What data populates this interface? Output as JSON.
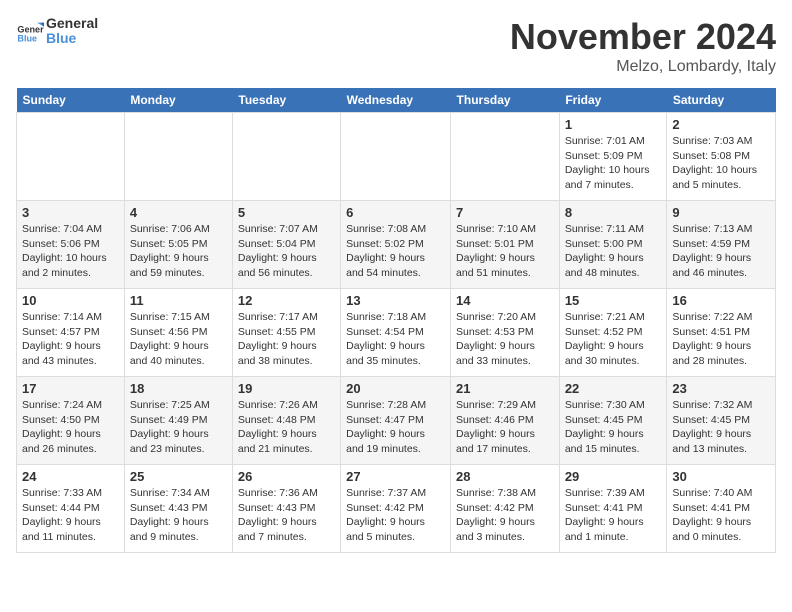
{
  "header": {
    "logo_general": "General",
    "logo_blue": "Blue",
    "month_title": "November 2024",
    "location": "Melzo, Lombardy, Italy"
  },
  "days_of_week": [
    "Sunday",
    "Monday",
    "Tuesday",
    "Wednesday",
    "Thursday",
    "Friday",
    "Saturday"
  ],
  "weeks": [
    [
      {
        "day": "",
        "info": ""
      },
      {
        "day": "",
        "info": ""
      },
      {
        "day": "",
        "info": ""
      },
      {
        "day": "",
        "info": ""
      },
      {
        "day": "",
        "info": ""
      },
      {
        "day": "1",
        "info": "Sunrise: 7:01 AM\nSunset: 5:09 PM\nDaylight: 10 hours and 7 minutes."
      },
      {
        "day": "2",
        "info": "Sunrise: 7:03 AM\nSunset: 5:08 PM\nDaylight: 10 hours and 5 minutes."
      }
    ],
    [
      {
        "day": "3",
        "info": "Sunrise: 7:04 AM\nSunset: 5:06 PM\nDaylight: 10 hours and 2 minutes."
      },
      {
        "day": "4",
        "info": "Sunrise: 7:06 AM\nSunset: 5:05 PM\nDaylight: 9 hours and 59 minutes."
      },
      {
        "day": "5",
        "info": "Sunrise: 7:07 AM\nSunset: 5:04 PM\nDaylight: 9 hours and 56 minutes."
      },
      {
        "day": "6",
        "info": "Sunrise: 7:08 AM\nSunset: 5:02 PM\nDaylight: 9 hours and 54 minutes."
      },
      {
        "day": "7",
        "info": "Sunrise: 7:10 AM\nSunset: 5:01 PM\nDaylight: 9 hours and 51 minutes."
      },
      {
        "day": "8",
        "info": "Sunrise: 7:11 AM\nSunset: 5:00 PM\nDaylight: 9 hours and 48 minutes."
      },
      {
        "day": "9",
        "info": "Sunrise: 7:13 AM\nSunset: 4:59 PM\nDaylight: 9 hours and 46 minutes."
      }
    ],
    [
      {
        "day": "10",
        "info": "Sunrise: 7:14 AM\nSunset: 4:57 PM\nDaylight: 9 hours and 43 minutes."
      },
      {
        "day": "11",
        "info": "Sunrise: 7:15 AM\nSunset: 4:56 PM\nDaylight: 9 hours and 40 minutes."
      },
      {
        "day": "12",
        "info": "Sunrise: 7:17 AM\nSunset: 4:55 PM\nDaylight: 9 hours and 38 minutes."
      },
      {
        "day": "13",
        "info": "Sunrise: 7:18 AM\nSunset: 4:54 PM\nDaylight: 9 hours and 35 minutes."
      },
      {
        "day": "14",
        "info": "Sunrise: 7:20 AM\nSunset: 4:53 PM\nDaylight: 9 hours and 33 minutes."
      },
      {
        "day": "15",
        "info": "Sunrise: 7:21 AM\nSunset: 4:52 PM\nDaylight: 9 hours and 30 minutes."
      },
      {
        "day": "16",
        "info": "Sunrise: 7:22 AM\nSunset: 4:51 PM\nDaylight: 9 hours and 28 minutes."
      }
    ],
    [
      {
        "day": "17",
        "info": "Sunrise: 7:24 AM\nSunset: 4:50 PM\nDaylight: 9 hours and 26 minutes."
      },
      {
        "day": "18",
        "info": "Sunrise: 7:25 AM\nSunset: 4:49 PM\nDaylight: 9 hours and 23 minutes."
      },
      {
        "day": "19",
        "info": "Sunrise: 7:26 AM\nSunset: 4:48 PM\nDaylight: 9 hours and 21 minutes."
      },
      {
        "day": "20",
        "info": "Sunrise: 7:28 AM\nSunset: 4:47 PM\nDaylight: 9 hours and 19 minutes."
      },
      {
        "day": "21",
        "info": "Sunrise: 7:29 AM\nSunset: 4:46 PM\nDaylight: 9 hours and 17 minutes."
      },
      {
        "day": "22",
        "info": "Sunrise: 7:30 AM\nSunset: 4:45 PM\nDaylight: 9 hours and 15 minutes."
      },
      {
        "day": "23",
        "info": "Sunrise: 7:32 AM\nSunset: 4:45 PM\nDaylight: 9 hours and 13 minutes."
      }
    ],
    [
      {
        "day": "24",
        "info": "Sunrise: 7:33 AM\nSunset: 4:44 PM\nDaylight: 9 hours and 11 minutes."
      },
      {
        "day": "25",
        "info": "Sunrise: 7:34 AM\nSunset: 4:43 PM\nDaylight: 9 hours and 9 minutes."
      },
      {
        "day": "26",
        "info": "Sunrise: 7:36 AM\nSunset: 4:43 PM\nDaylight: 9 hours and 7 minutes."
      },
      {
        "day": "27",
        "info": "Sunrise: 7:37 AM\nSunset: 4:42 PM\nDaylight: 9 hours and 5 minutes."
      },
      {
        "day": "28",
        "info": "Sunrise: 7:38 AM\nSunset: 4:42 PM\nDaylight: 9 hours and 3 minutes."
      },
      {
        "day": "29",
        "info": "Sunrise: 7:39 AM\nSunset: 4:41 PM\nDaylight: 9 hours and 1 minute."
      },
      {
        "day": "30",
        "info": "Sunrise: 7:40 AM\nSunset: 4:41 PM\nDaylight: 9 hours and 0 minutes."
      }
    ]
  ]
}
